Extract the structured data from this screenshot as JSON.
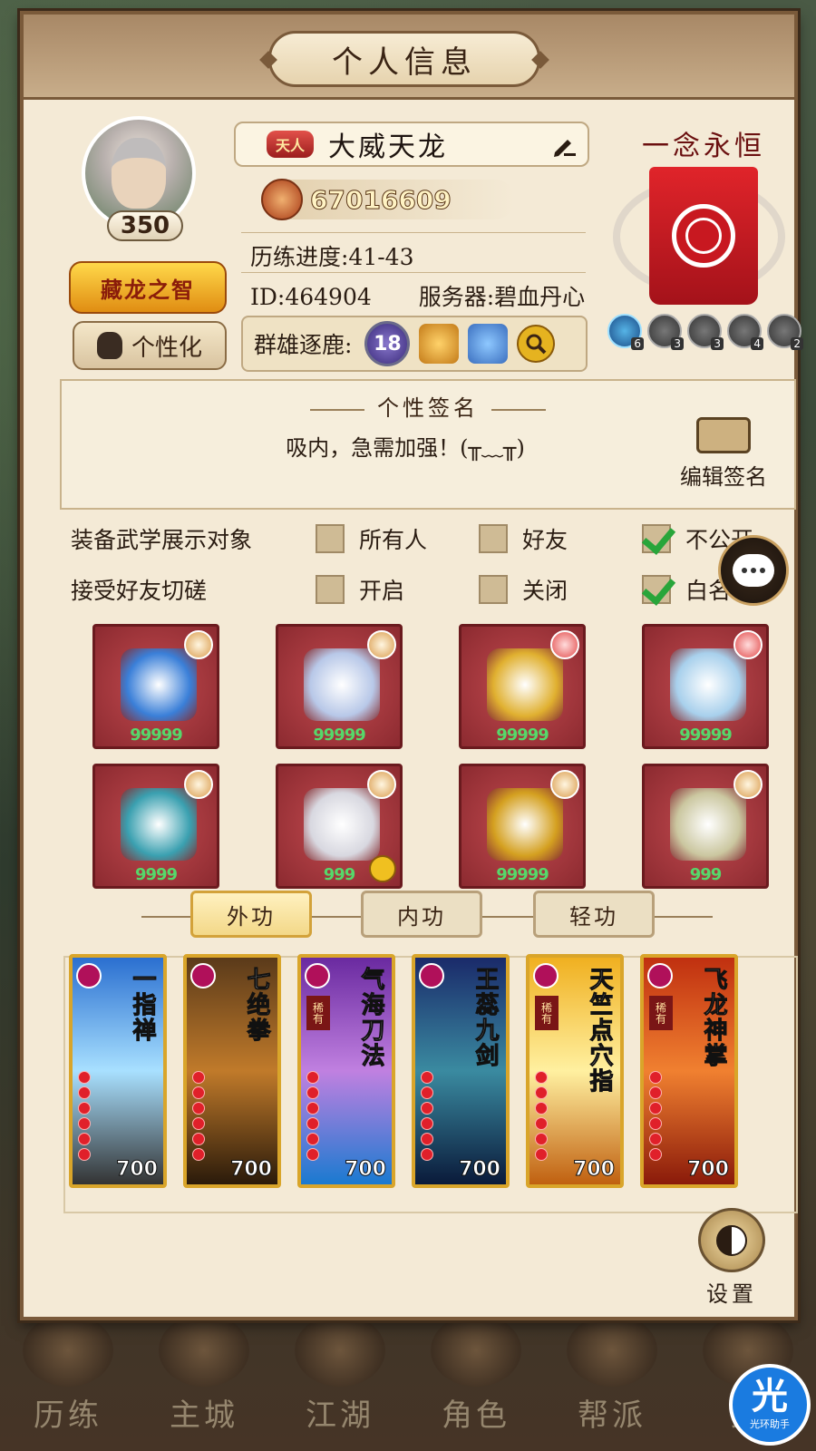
{
  "header": {
    "title": "个人信息"
  },
  "player": {
    "level": "350",
    "title_badge": "藏龙之智",
    "customize_label": "个性化",
    "rank_tag": "天人",
    "name": "大威天龙",
    "power": "67016609",
    "progress": "历练进度:41-43",
    "id": "ID:464904",
    "server": "服务器:碧血丹心",
    "arena_label": "群雄逐鹿:",
    "arena_rank": "18"
  },
  "guild": {
    "name": "一念永恒",
    "medals": [
      {
        "count": "6",
        "active": true
      },
      {
        "count": "3",
        "active": false
      },
      {
        "count": "3",
        "active": false
      },
      {
        "count": "4",
        "active": false
      },
      {
        "count": "2",
        "active": false
      }
    ]
  },
  "signature": {
    "title": "个性签名",
    "text": "吸内，急需加强！(╥﹏╥)",
    "edit_label": "编辑签名"
  },
  "settings": {
    "display": {
      "label": "装备武学展示对象",
      "options": [
        "所有人",
        "好友",
        "不公开"
      ],
      "checked": 2
    },
    "sparring": {
      "label": "接受好友切磋",
      "options": [
        "开启",
        "关闭",
        "白名"
      ],
      "checked": 2
    }
  },
  "equipment": [
    {
      "stars": "99999",
      "badge": "normal",
      "color": "#3a7fd8",
      "icon": "gauntlet-icon"
    },
    {
      "stars": "99999",
      "badge": "normal",
      "color": "#b8c8e8",
      "icon": "robe-icon"
    },
    {
      "stars": "99999",
      "badge": "red",
      "color": "#e0b030",
      "icon": "belt-icon"
    },
    {
      "stars": "99999",
      "badge": "red",
      "color": "#a8d0ec",
      "icon": "boots-icon"
    },
    {
      "stars": "9999",
      "badge": "normal",
      "color": "#3aa0b0",
      "icon": "necklace-icon"
    },
    {
      "stars": "999",
      "badge": "normal",
      "color": "#d8d8e0",
      "icon": "hairpin-icon",
      "linked": true
    },
    {
      "stars": "99999",
      "badge": "normal",
      "color": "#d4a020",
      "icon": "bracelet-icon"
    },
    {
      "stars": "999",
      "badge": "normal",
      "color": "#cbc7a0",
      "icon": "ring-icon"
    }
  ],
  "tabs": [
    "外功",
    "内功",
    "轻功"
  ],
  "skills": [
    {
      "name": "一指禅",
      "power": "700",
      "rare": false,
      "bg": "linear-gradient(180deg,#2a6fd0,#a8e0ff,#333)"
    },
    {
      "name": "七绝拳",
      "power": "700",
      "rare": false,
      "bg": "linear-gradient(180deg,#5a3a1a,#c07a2a,#2a1a0a)"
    },
    {
      "name": "气海刀法",
      "power": "700",
      "rare": true,
      "rare_label": "稀有",
      "bg": "linear-gradient(180deg,#6a2aa0,#c080e0,#1a7ad0)"
    },
    {
      "name": "王蕊九剑",
      "power": "700",
      "rare": false,
      "bg": "linear-gradient(180deg,#1a2a6a,#3a8aa0,#0a1a3a)"
    },
    {
      "name": "天竺点穴指",
      "power": "700",
      "rare": true,
      "rare_label": "稀有",
      "bg": "linear-gradient(180deg,#f0b020,#fff0a0,#c06010)"
    },
    {
      "name": "飞龙神掌",
      "power": "700",
      "rare": true,
      "rare_label": "稀有",
      "bg": "linear-gradient(180deg,#c03010,#f08030,#8a1a0a)"
    }
  ],
  "settings_button": "设置",
  "bottom_nav": [
    "历练",
    "主城",
    "江湖",
    "角色",
    "帮派",
    "武"
  ],
  "helper": {
    "logo": "光",
    "name": "光环助手"
  }
}
